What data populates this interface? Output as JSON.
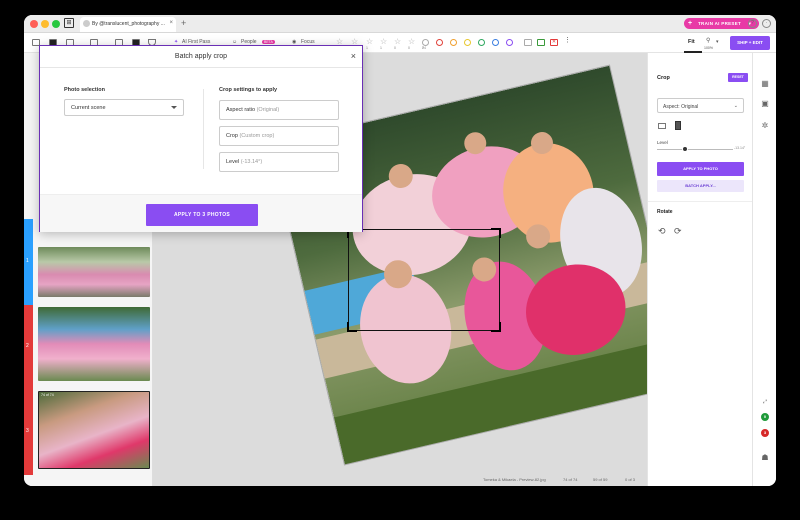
{
  "browser": {
    "tab_title": "By @translucent_photography ...",
    "tab_close": "×",
    "new_tab": "+",
    "train_button": "TRAIN AI PRESET",
    "train_plus": "+",
    "dropdown": "▾"
  },
  "toolbar": {
    "ai_first_pass": "AI First Pass",
    "people": "People",
    "people_badge": "BETA",
    "focus": "Focus",
    "star_counts": [
      "2",
      "1",
      "1",
      "0",
      "0",
      "0",
      "74"
    ],
    "fit": "Fit",
    "zoom": "100%",
    "ship_edit": "SHIP + EDIT",
    "icon_colors": [
      "#e0423a",
      "#f0a030",
      "#e8c830",
      "#30a860",
      "#3a7ee0",
      "#8a4df2"
    ]
  },
  "filmstrip": {
    "rows": [
      {
        "number": "1",
        "color": "#2aa0ff"
      },
      {
        "number": "2",
        "color": "#e33a3a"
      },
      {
        "number": "3",
        "color": "#e33a3a"
      }
    ],
    "current_count": "74 of 74"
  },
  "modal": {
    "title": "Batch apply crop",
    "close": "×",
    "photo_selection_label": "Photo selection",
    "photo_selection_value": "Current scene",
    "crop_settings_label": "Crop settings to apply",
    "aspect_ratio": "Aspect ratio",
    "aspect_ratio_value": "(Original)",
    "crop": "Crop",
    "crop_value": "(Custom crop)",
    "level": "Level",
    "level_value": "(-13.14°)",
    "apply_button": "APPLY TO 3 PHOTOS"
  },
  "status": {
    "filename": "Tomeka & Mikaela - Preview-82.jpg",
    "position": "74 of 74",
    "visible": "59 of 59",
    "selected": "0 of 3"
  },
  "right_panel": {
    "crop_title": "Crop",
    "reset": "RESET",
    "aspect": "Aspect: Original",
    "level_label": "Level",
    "level_value": "-13.14°",
    "level_fraction": 0.37,
    "apply_to_photo": "APPLY TO PHOTO",
    "batch_apply": "BATCH APPLY...",
    "rotate_title": "Rotate"
  },
  "side_badges": {
    "green": "0",
    "red": "3"
  }
}
